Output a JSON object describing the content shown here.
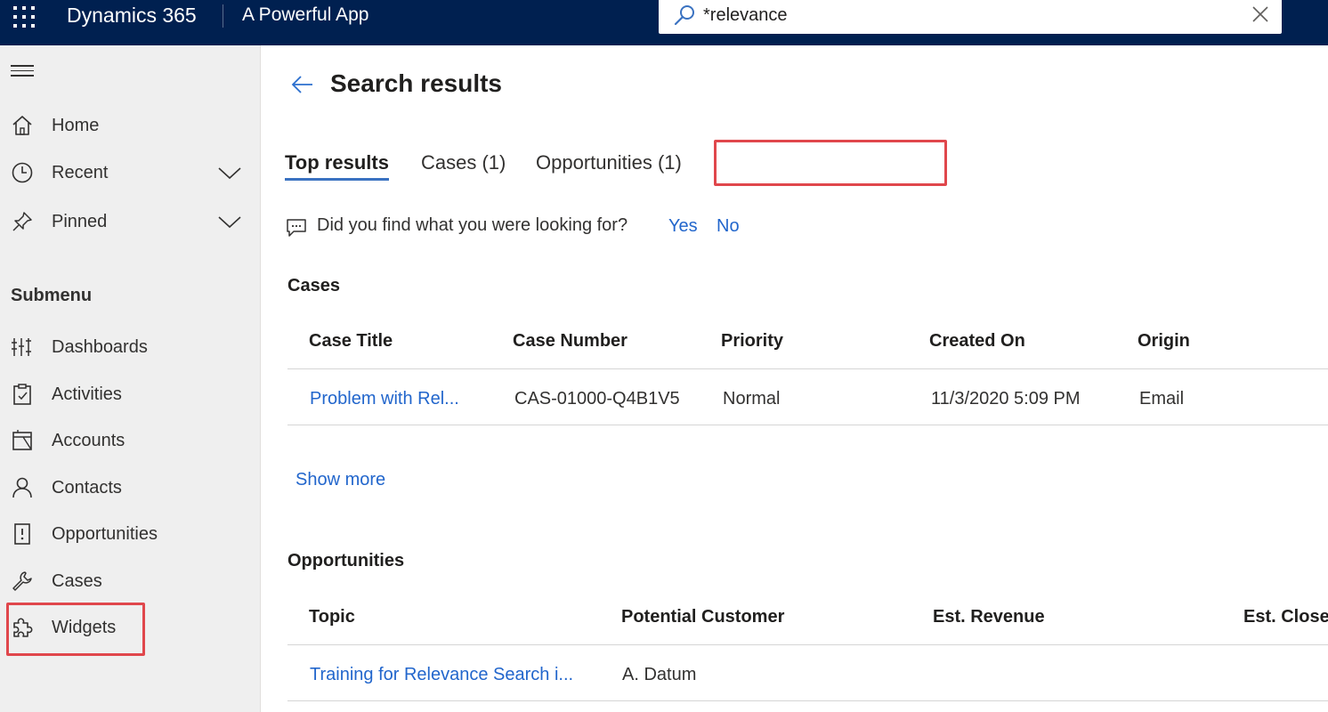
{
  "header": {
    "app_name": "Dynamics 365",
    "app_subtitle": "A Powerful App",
    "search_value": "*relevance",
    "brand_color": "#002050"
  },
  "sidebar": {
    "items": [
      {
        "label": "Home",
        "icon": "home-icon"
      },
      {
        "label": "Recent",
        "icon": "clock-icon",
        "expandable": true
      },
      {
        "label": "Pinned",
        "icon": "pin-icon",
        "expandable": true
      }
    ],
    "submenu_title": "Submenu",
    "submenu_items": [
      {
        "label": "Dashboards",
        "icon": "dashboard-icon"
      },
      {
        "label": "Activities",
        "icon": "clipboard-icon"
      },
      {
        "label": "Accounts",
        "icon": "building-icon"
      },
      {
        "label": "Contacts",
        "icon": "person-icon"
      },
      {
        "label": "Opportunities",
        "icon": "opportunity-icon"
      },
      {
        "label": "Cases",
        "icon": "wrench-icon"
      },
      {
        "label": "Widgets",
        "icon": "puzzle-icon",
        "highlighted": true
      }
    ]
  },
  "main": {
    "title": "Search results",
    "tabs": [
      {
        "label": "Top results",
        "active": true
      },
      {
        "label": "Cases (1)"
      },
      {
        "label": "Opportunities (1)"
      }
    ],
    "feedback": {
      "question": "Did you find what you were looking for?",
      "yes": "Yes",
      "no": "No"
    },
    "cases": {
      "title": "Cases",
      "columns": [
        "Case Title",
        "Case Number",
        "Priority",
        "Created On",
        "Origin"
      ],
      "rows": [
        [
          "Problem with Rel...",
          "CAS-01000-Q4B1V5",
          "Normal",
          "11/3/2020 5:09 PM",
          "Email"
        ]
      ],
      "show_more": "Show more"
    },
    "opportunities": {
      "title": "Opportunities",
      "columns": [
        "Topic",
        "Potential Customer",
        "Est. Revenue",
        "Est. Close"
      ],
      "rows": [
        [
          "Training for Relevance Search i...",
          "A. Datum",
          "",
          ""
        ]
      ]
    }
  },
  "colors": {
    "accent": "#3a72c1",
    "link": "#2266cc",
    "highlight": "#e0474c"
  }
}
